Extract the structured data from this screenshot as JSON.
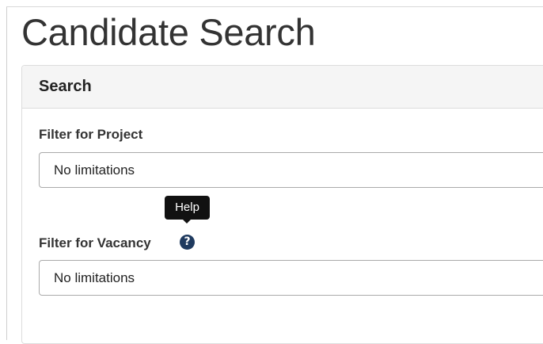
{
  "page": {
    "title": "Candidate Search"
  },
  "panel": {
    "heading": "Search"
  },
  "filters": {
    "project": {
      "label": "Filter for Project",
      "selected": "No limitations"
    },
    "vacancy": {
      "label": "Filter for Vacancy",
      "selected": "No limitations",
      "help_icon": "question-circle-icon"
    }
  },
  "tooltip": {
    "text": "Help"
  },
  "colors": {
    "panel_heading_bg": "#f5f5f5",
    "help_icon": "#1f3a5f",
    "tooltip_bg": "#111111"
  }
}
